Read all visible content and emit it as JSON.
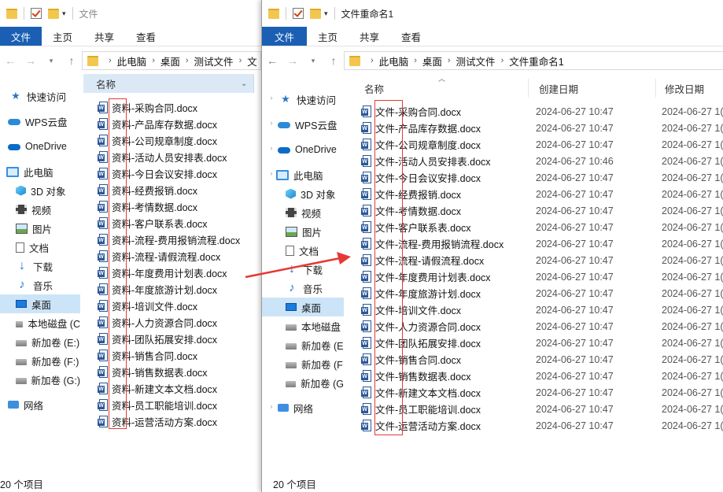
{
  "left": {
    "title": "文件",
    "status": "20 个项目",
    "breadcrumb": [
      "此电脑",
      "桌面",
      "测试文件",
      "文"
    ],
    "col_name": "名称",
    "files": [
      "资料-采购合同.docx",
      "资料-产品库存数据.docx",
      "资料-公司规章制度.docx",
      "资料-活动人员安排表.docx",
      "资料-今日会议安排.docx",
      "资料-经费报销.docx",
      "资料-考情数据.docx",
      "资料-客户联系表.docx",
      "资料-流程-费用报销流程.docx",
      "资料-流程-请假流程.docx",
      "资料-年度费用计划表.docx",
      "资料-年度旅游计划.docx",
      "资料-培训文件.docx",
      "资料-人力资源合同.docx",
      "资料-团队拓展安排.docx",
      "资料-销售合同.docx",
      "资料-销售数据表.docx",
      "资料-新建文本文档.docx",
      "资料-员工职能培训.docx",
      "资料-运营活动方案.docx"
    ]
  },
  "right": {
    "title": "文件重命名1",
    "status": "20 个项目",
    "breadcrumb": [
      "此电脑",
      "桌面",
      "测试文件",
      "文件重命名1"
    ],
    "col_name": "名称",
    "col_created": "创建日期",
    "col_modified": "修改日期",
    "files": [
      {
        "name": "文件-采购合同.docx",
        "created": "2024-06-27 10:47",
        "modified": "2024-06-27 1("
      },
      {
        "name": "文件-产品库存数据.docx",
        "created": "2024-06-27 10:47",
        "modified": "2024-06-27 1("
      },
      {
        "name": "文件-公司规章制度.docx",
        "created": "2024-06-27 10:47",
        "modified": "2024-06-27 1("
      },
      {
        "name": "文件-活动人员安排表.docx",
        "created": "2024-06-27 10:46",
        "modified": "2024-06-27 1("
      },
      {
        "name": "文件-今日会议安排.docx",
        "created": "2024-06-27 10:47",
        "modified": "2024-06-27 1("
      },
      {
        "name": "文件-经费报销.docx",
        "created": "2024-06-27 10:47",
        "modified": "2024-06-27 1("
      },
      {
        "name": "文件-考情数据.docx",
        "created": "2024-06-27 10:47",
        "modified": "2024-06-27 1("
      },
      {
        "name": "文件-客户联系表.docx",
        "created": "2024-06-27 10:47",
        "modified": "2024-06-27 1("
      },
      {
        "name": "文件-流程-费用报销流程.docx",
        "created": "2024-06-27 10:47",
        "modified": "2024-06-27 1("
      },
      {
        "name": "文件-流程-请假流程.docx",
        "created": "2024-06-27 10:47",
        "modified": "2024-06-27 1("
      },
      {
        "name": "文件-年度费用计划表.docx",
        "created": "2024-06-27 10:47",
        "modified": "2024-06-27 1("
      },
      {
        "name": "文件-年度旅游计划.docx",
        "created": "2024-06-27 10:47",
        "modified": "2024-06-27 1("
      },
      {
        "name": "文件-培训文件.docx",
        "created": "2024-06-27 10:47",
        "modified": "2024-06-27 1("
      },
      {
        "name": "文件-人力资源合同.docx",
        "created": "2024-06-27 10:47",
        "modified": "2024-06-27 1("
      },
      {
        "name": "文件-团队拓展安排.docx",
        "created": "2024-06-27 10:47",
        "modified": "2024-06-27 1("
      },
      {
        "name": "文件-销售合同.docx",
        "created": "2024-06-27 10:47",
        "modified": "2024-06-27 1("
      },
      {
        "name": "文件-销售数据表.docx",
        "created": "2024-06-27 10:47",
        "modified": "2024-06-27 1("
      },
      {
        "name": "文件-新建文本文档.docx",
        "created": "2024-06-27 10:47",
        "modified": "2024-06-27 1("
      },
      {
        "name": "文件-员工职能培训.docx",
        "created": "2024-06-27 10:47",
        "modified": "2024-06-27 1("
      },
      {
        "name": "文件-运营活动方案.docx",
        "created": "2024-06-27 10:47",
        "modified": "2024-06-27 1("
      }
    ]
  },
  "ribbon": [
    "文件",
    "主页",
    "共享",
    "查看"
  ],
  "sidebar": [
    {
      "label": "快速访问",
      "icon": "star-icon"
    },
    {
      "label": "WPS云盘",
      "icon": "cloud-icon"
    },
    {
      "label": "OneDrive",
      "icon": "onedrive-icon"
    },
    {
      "label": "此电脑",
      "icon": "computer-icon"
    },
    {
      "label": "3D 对象",
      "icon": "3d-objects-icon"
    },
    {
      "label": "视频",
      "icon": "video-icon"
    },
    {
      "label": "图片",
      "icon": "picture-icon"
    },
    {
      "label": "文档",
      "icon": "document-icon"
    },
    {
      "label": "下载",
      "icon": "download-icon"
    },
    {
      "label": "音乐",
      "icon": "music-icon"
    },
    {
      "label": "桌面",
      "icon": "desktop-icon"
    },
    {
      "label": "本地磁盘 (C",
      "icon": "drive-icon"
    },
    {
      "label": "新加卷 (E:)",
      "icon": "drive-icon"
    },
    {
      "label": "新加卷 (F:)",
      "icon": "drive-icon"
    },
    {
      "label": "新加卷 (G:)",
      "icon": "drive-icon"
    },
    {
      "label": "网络",
      "icon": "network-icon"
    }
  ],
  "sidebar_right": [
    "快速访问",
    "WPS云盘",
    "OneDrive",
    "此电脑",
    "3D 对象",
    "视频",
    "图片",
    "文档",
    "下载",
    "音乐",
    "桌面",
    "本地磁盘",
    "新加卷 (E",
    "新加卷 (F",
    "新加卷 (G",
    "网络"
  ],
  "colors": {
    "accent": "#1a5fb4",
    "selection": "#cce4f7",
    "highlight": "#e53935"
  }
}
